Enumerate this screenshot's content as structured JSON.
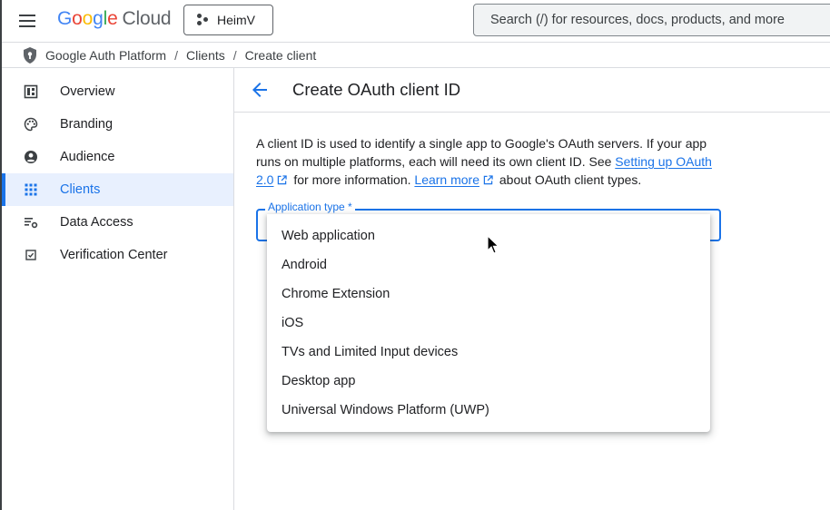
{
  "topbar": {
    "logo_letters": [
      "G",
      "o",
      "o",
      "g",
      "l",
      "e"
    ],
    "logo_product": "Cloud",
    "project_name": "HeimV",
    "search_placeholder": "Search (/) for resources, docs, products, and more"
  },
  "breadcrumb": [
    "Google Auth Platform",
    "Clients",
    "Create client"
  ],
  "breadcrumb_separator": "/",
  "sidebar": {
    "items": [
      {
        "label": "Overview",
        "icon": "dashboard-icon"
      },
      {
        "label": "Branding",
        "icon": "palette-icon"
      },
      {
        "label": "Audience",
        "icon": "account-circle-icon"
      },
      {
        "label": "Clients",
        "icon": "apps-grid-icon",
        "active": true
      },
      {
        "label": "Data Access",
        "icon": "data-settings-icon"
      },
      {
        "label": "Verification Center",
        "icon": "verified-check-icon"
      }
    ]
  },
  "page": {
    "title": "Create OAuth client ID",
    "intro_1": "A client ID is used to identify a single app to Google's OAuth servers. If your app runs on multiple platforms, each will need its own client ID. See ",
    "intro_link_1": "Setting up OAuth 2.0",
    "intro_2": " for more information. ",
    "intro_link_2": "Learn more",
    "intro_3": " about OAuth client types."
  },
  "form": {
    "application_type_label": "Application type *",
    "application_type_value": "",
    "options": [
      "Web application",
      "Android",
      "Chrome Extension",
      "iOS",
      "TVs and Limited Input devices",
      "Desktop app",
      "Universal Windows Platform (UWP)"
    ]
  },
  "colors": {
    "accent": "#1a73e8",
    "active_bg": "#e8f0fe",
    "text": "#202124",
    "divider": "#dadce0"
  }
}
